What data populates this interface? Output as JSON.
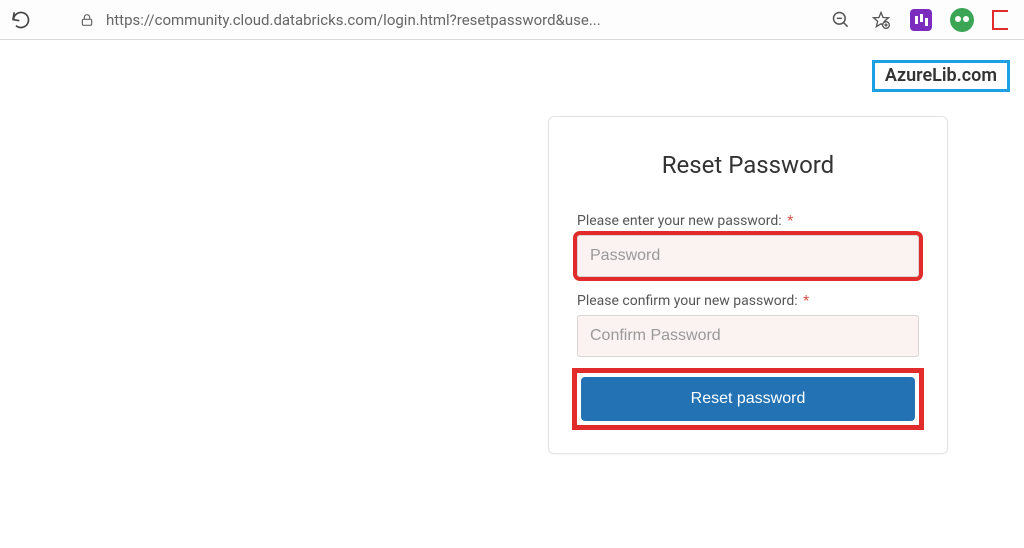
{
  "browser": {
    "url": "https://community.cloud.databricks.com/login.html?resetpassword&use..."
  },
  "watermark": {
    "text": "AzureLib.com"
  },
  "form": {
    "title": "Reset Password",
    "password_label": "Please enter your new password:",
    "password_placeholder": "Password",
    "confirm_label": "Please confirm your new password:",
    "confirm_placeholder": "Confirm Password",
    "submit_label": "Reset password",
    "required_marker": "*"
  }
}
